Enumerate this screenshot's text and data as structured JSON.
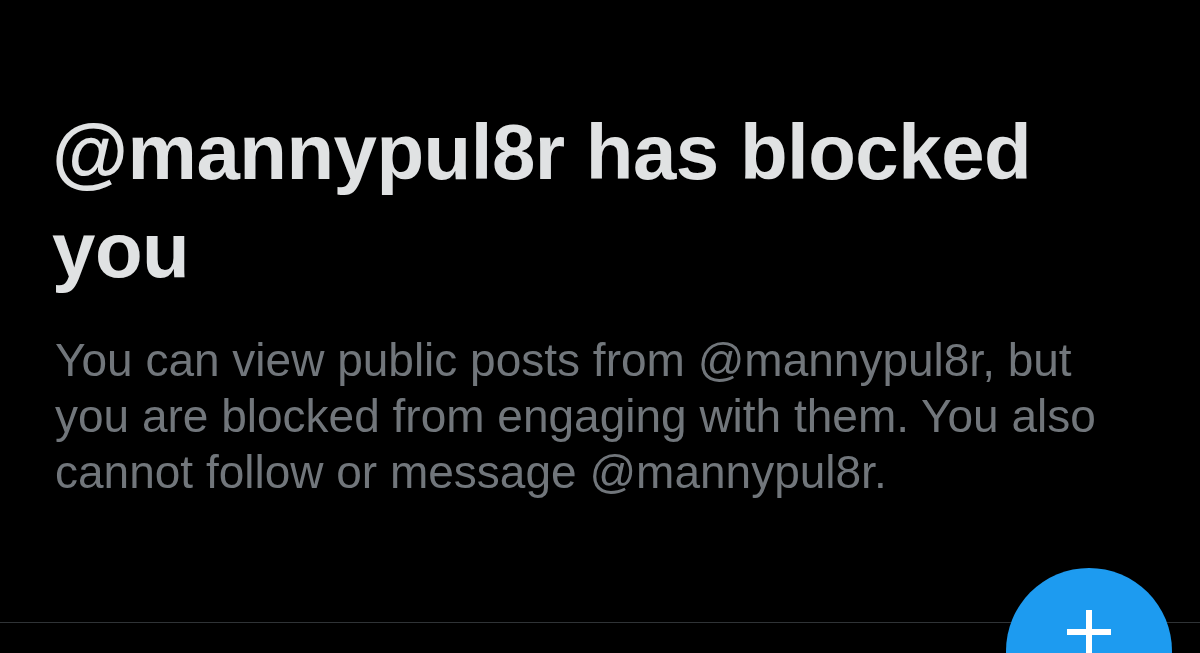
{
  "title": "@mannypul8r has blocked you",
  "message": "You can view public posts from @mannypul8r, but you are blocked from engaging with them. You also cannot follow or message @mannypul8r."
}
